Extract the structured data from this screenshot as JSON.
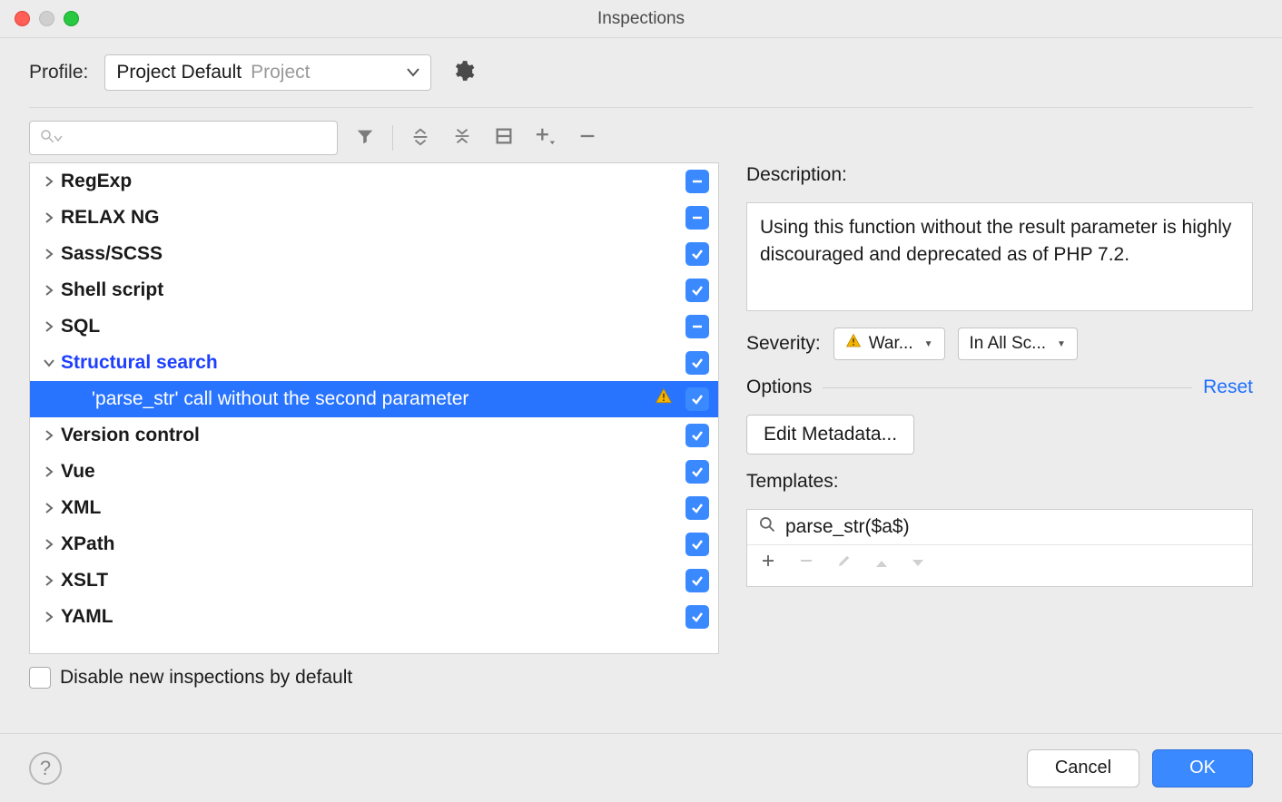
{
  "window_title": "Inspections",
  "profile": {
    "label": "Profile:",
    "value": "Project Default",
    "secondary": "Project"
  },
  "tree": [
    {
      "label": "RegExp",
      "expanded": false,
      "check": "minus"
    },
    {
      "label": "RELAX NG",
      "expanded": false,
      "check": "minus"
    },
    {
      "label": "Sass/SCSS",
      "expanded": false,
      "check": "check"
    },
    {
      "label": "Shell script",
      "expanded": false,
      "check": "check"
    },
    {
      "label": "SQL",
      "expanded": false,
      "check": "minus"
    },
    {
      "label": "Structural search",
      "expanded": true,
      "check": "check",
      "highlight": true
    },
    {
      "label": "'parse_str' call without the second parameter",
      "child": true,
      "selected": true,
      "warn": true,
      "check": "check"
    },
    {
      "label": "Version control",
      "expanded": false,
      "check": "check"
    },
    {
      "label": "Vue",
      "expanded": false,
      "check": "check"
    },
    {
      "label": "XML",
      "expanded": false,
      "check": "check"
    },
    {
      "label": "XPath",
      "expanded": false,
      "check": "check"
    },
    {
      "label": "XSLT",
      "expanded": false,
      "check": "check"
    },
    {
      "label": "YAML",
      "expanded": false,
      "check": "check"
    }
  ],
  "disable_new_label": "Disable new inspections by default",
  "details": {
    "description_label": "Description:",
    "description": "Using this function without the result parameter is highly discouraged and deprecated as of PHP 7.2.",
    "severity_label": "Severity:",
    "severity_value": "War...",
    "scope_value": "In All Sc...",
    "options_label": "Options",
    "reset_label": "Reset",
    "edit_metadata": "Edit Metadata...",
    "templates_label": "Templates:",
    "template_search_value": "parse_str($a$)"
  },
  "buttons": {
    "cancel": "Cancel",
    "ok": "OK"
  }
}
